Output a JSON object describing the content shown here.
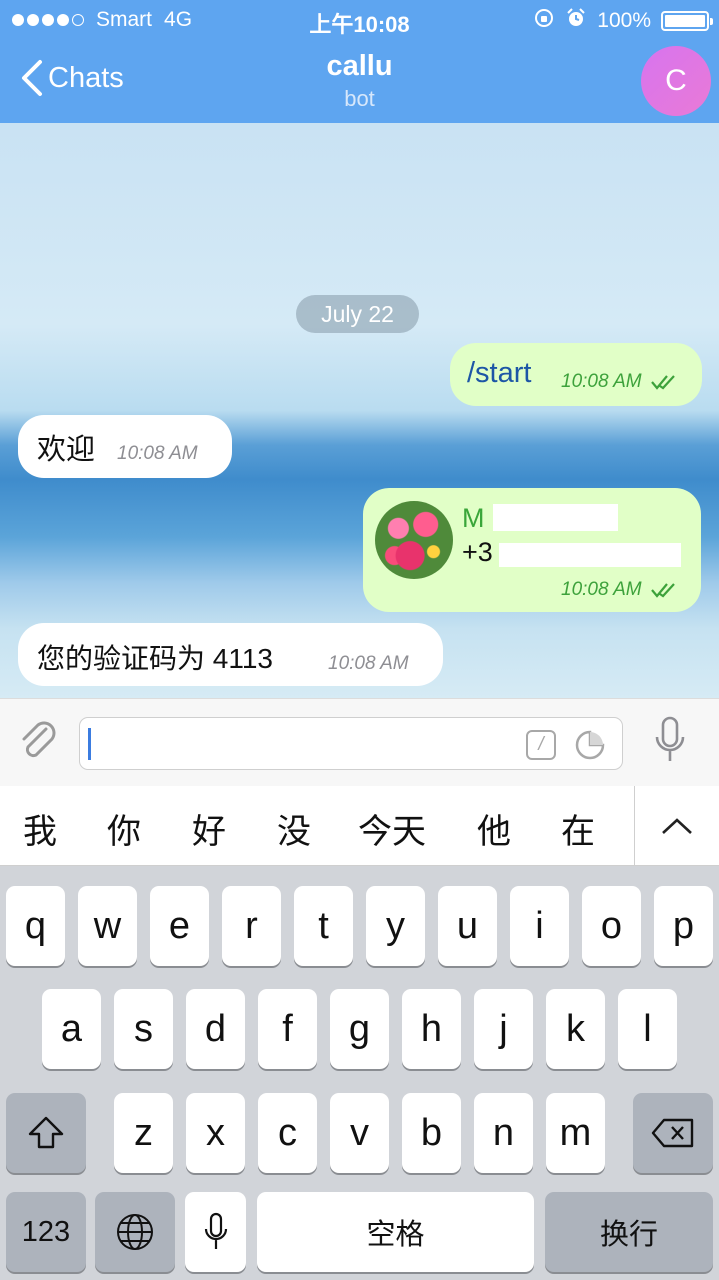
{
  "status_bar": {
    "carrier": "Smart",
    "network": "4G",
    "time": "上午10:08",
    "battery": "100%",
    "battery_fill": 1.0
  },
  "nav": {
    "back_label": "Chats",
    "title": "callu",
    "subtitle": "bot",
    "avatar_letter": "C"
  },
  "chat": {
    "date": "July 22",
    "messages": [
      {
        "direction": "out",
        "text": "/start",
        "time": "10:08 AM"
      },
      {
        "direction": "in",
        "text": "欢迎",
        "time": "10:08 AM"
      },
      {
        "direction": "out",
        "type": "contact",
        "name": "M",
        "phone": "+3",
        "time": "10:08 AM"
      },
      {
        "direction": "in",
        "text": "您的验证码为 4113",
        "time": "10:08 AM"
      }
    ]
  },
  "input": {
    "value": "",
    "command_icon": "/"
  },
  "candidates": [
    "我",
    "你",
    "好",
    "没",
    "今天",
    "他",
    "在"
  ],
  "keyboard": {
    "row1": [
      "q",
      "w",
      "e",
      "r",
      "t",
      "y",
      "u",
      "i",
      "o",
      "p"
    ],
    "row2": [
      "a",
      "s",
      "d",
      "f",
      "g",
      "h",
      "j",
      "k",
      "l"
    ],
    "row3": [
      "z",
      "x",
      "c",
      "v",
      "b",
      "n",
      "m"
    ],
    "numbers": "123",
    "space": "空格",
    "return": "换行"
  },
  "colors": {
    "nav_bg": "#5ea5f0",
    "out_bubble": "#e1ffc7",
    "in_bubble": "#ffffff",
    "check_green": "#3da23b"
  }
}
